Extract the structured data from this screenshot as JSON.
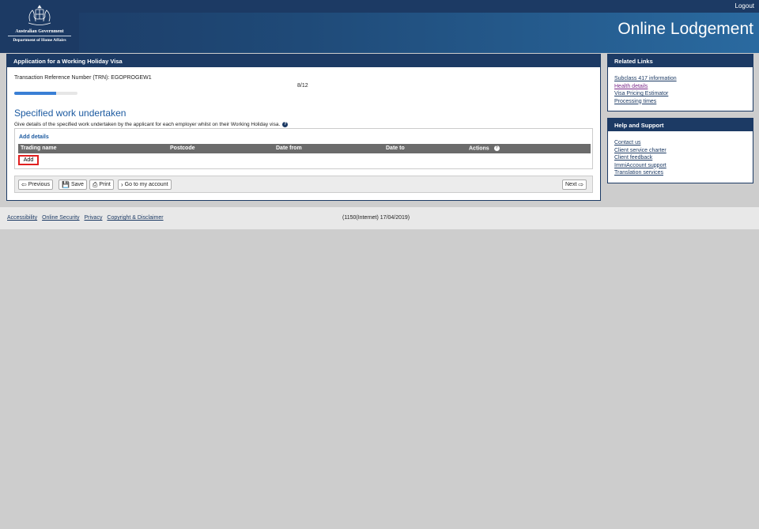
{
  "header": {
    "logout": "Logout",
    "gov_line1": "Australian Government",
    "gov_line2": "Department of Home Affairs",
    "app_title": "Online Lodgement"
  },
  "main": {
    "panel_title": "Application for a Working Holiday Visa",
    "trn": "Transaction Reference Number (TRN): EGOPROGEW1",
    "page_count": "8/12",
    "progress": 0.667,
    "section_title": "Specified work undertaken",
    "section_desc": "Give details of the specified work undertaken by the applicant for each employer whilst on their Working Holiday visa.",
    "add_details": "Add details",
    "columns": [
      "Trading name",
      "Postcode",
      "Date from",
      "Date to",
      "Actions"
    ],
    "add_button": "Add",
    "nav": {
      "previous": "Previous",
      "save": "Save",
      "print": "Print",
      "account": "Go to my account",
      "next": "Next"
    }
  },
  "related_links": {
    "title": "Related Links",
    "items": [
      "Subclass 417 information",
      "Health details",
      "Visa Pricing Estimator",
      "Processing times"
    ]
  },
  "help_support": {
    "title": "Help and Support",
    "items": [
      "Contact us",
      "Client service charter",
      "Client feedback",
      "ImmiAccount support",
      "Translation services"
    ]
  },
  "footer": {
    "links": [
      "Accessibility",
      "Online Security",
      "Privacy",
      "Copyright & Disclaimer"
    ],
    "build": "(1150(Internet) 17/04/2019)"
  },
  "colors": {
    "navy": "#1c3a64",
    "accent_blue": "#1c5aa0",
    "highlight_red": "#e02020"
  }
}
